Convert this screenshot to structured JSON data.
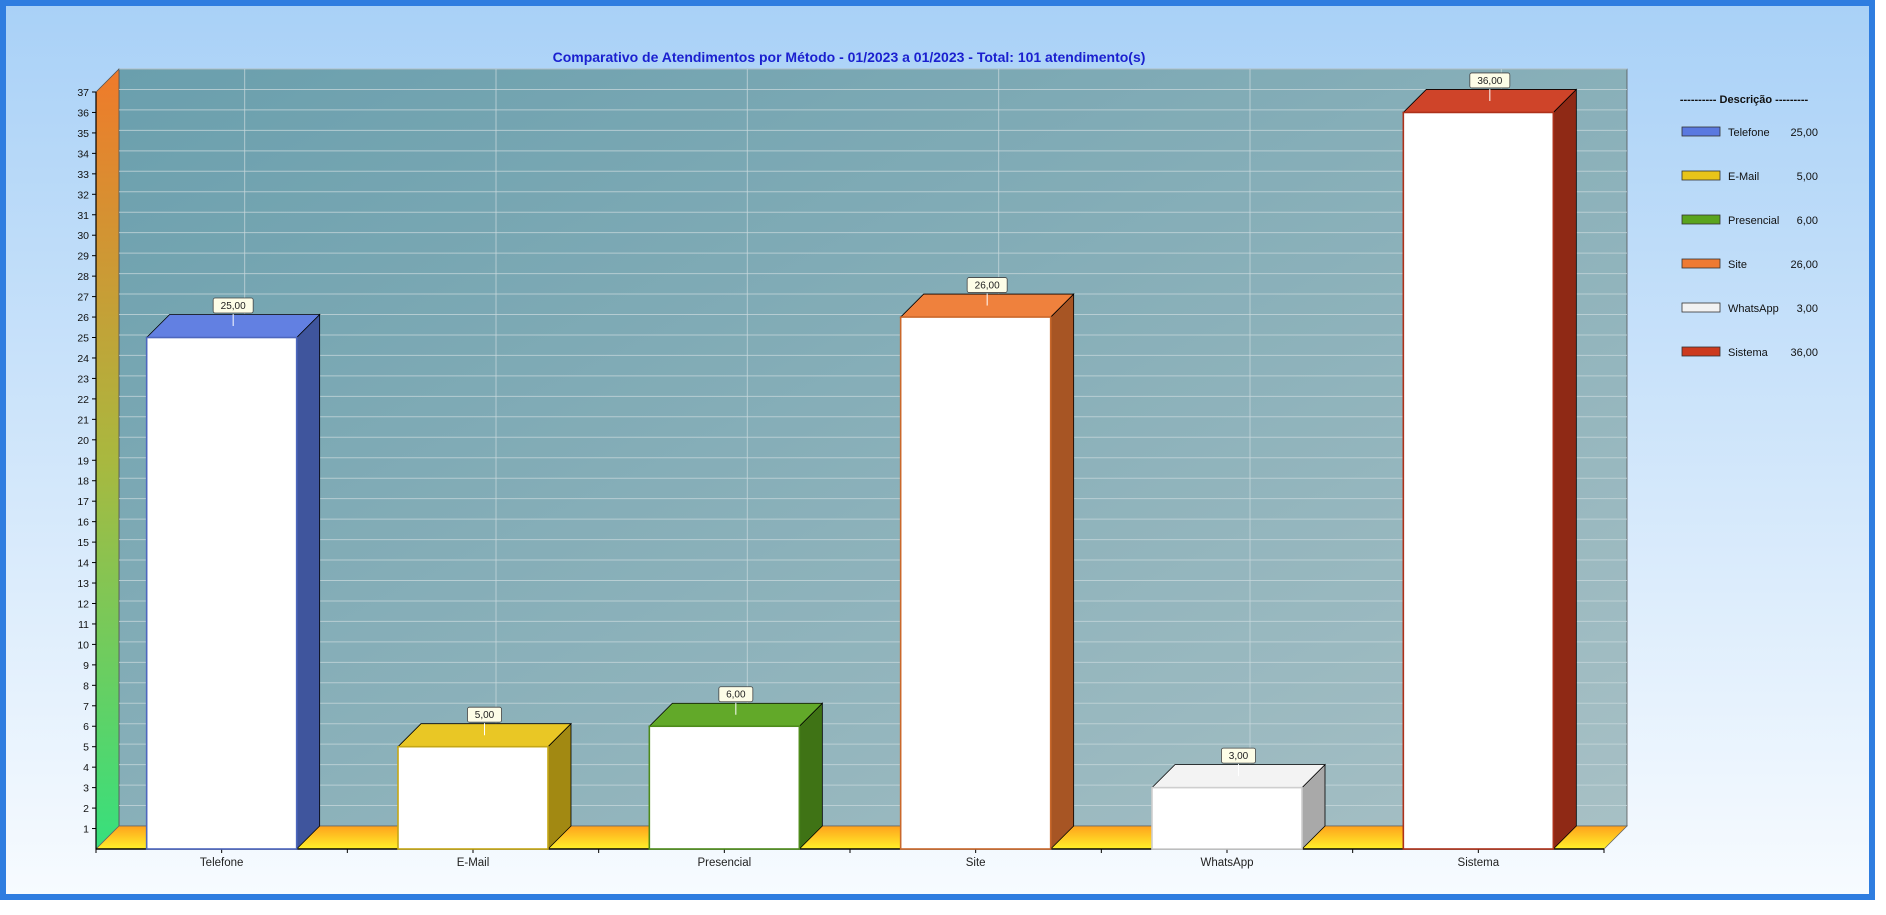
{
  "chart_data": {
    "type": "bar",
    "title": "Comparativo de Atendimentos por Método - 01/2023 a 01/2023 - Total: 101 atendimento(s)",
    "categories": [
      "Telefone",
      "E-Mail",
      "Presencial",
      "Site",
      "WhatsApp",
      "Sistema"
    ],
    "values": [
      25,
      5,
      6,
      26,
      3,
      36
    ],
    "data_labels": [
      "25,00",
      "5,00",
      "6,00",
      "26,00",
      "3,00",
      "36,00"
    ],
    "colors": [
      "#5a79e0",
      "#e8c419",
      "#5aa41e",
      "#ee7a33",
      "#f2f2f2",
      "#cc3a1e"
    ],
    "ylim": [
      0,
      37
    ],
    "yticks": [
      "1",
      "2",
      "3",
      "4",
      "5",
      "6",
      "7",
      "8",
      "9",
      "10",
      "11",
      "12",
      "13",
      "14",
      "15",
      "16",
      "17",
      "18",
      "19",
      "20",
      "21",
      "22",
      "23",
      "24",
      "25",
      "26",
      "27",
      "28",
      "29",
      "30",
      "31",
      "32",
      "33",
      "34",
      "35",
      "36",
      "37"
    ],
    "grid": true,
    "legend_position": "right",
    "legend": {
      "header": "---------- Descrição ---------",
      "entries": [
        {
          "name": "Telefone",
          "value": "25,00"
        },
        {
          "name": "E-Mail",
          "value": "5,00"
        },
        {
          "name": "Presencial",
          "value": "6,00"
        },
        {
          "name": "Site",
          "value": "26,00"
        },
        {
          "name": "WhatsApp",
          "value": "3,00"
        },
        {
          "name": "Sistema",
          "value": "36,00"
        }
      ]
    }
  }
}
